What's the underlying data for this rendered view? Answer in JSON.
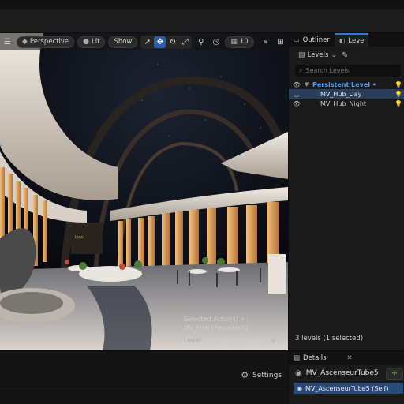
{
  "viewport": {
    "toolbar": {
      "menu_icon": "hamburger-icon",
      "perspective_label": "Perspective",
      "lit_label": "Lit",
      "show_label": "Show",
      "grid_value": "10"
    },
    "selection": {
      "line1": "Selected Actor(s) in:",
      "line2": "MV_Hub (Persistent)",
      "level_label": "Level:",
      "level_value": "MV_Hub (Persistent)"
    }
  },
  "bottombar": {
    "settings_label": "Settings"
  },
  "outliner": {
    "tab_outliner": "Outliner",
    "tab_levels": "Leve",
    "levels_button": "Levels",
    "search_placeholder": "Search Levels",
    "rows": [
      {
        "name": "Persistent Level •",
        "type": "persistent"
      },
      {
        "name": "MV_Hub_Day",
        "type": "selected"
      },
      {
        "name": "MV_Hub_Night",
        "type": "normal"
      }
    ],
    "count_text": "3 levels (1 selected)"
  },
  "details": {
    "tab_label": "Details",
    "actor_name": "MV_AscenseurTube5",
    "add_label": "+ A",
    "component_label": "MV_AscenseurTube5 (Self)"
  },
  "colors": {
    "accent_blue": "#2f78d4",
    "persistent_blue": "#4aa0ff",
    "selected_row": "#2a3e5c",
    "add_green": "#6ebc3c"
  }
}
